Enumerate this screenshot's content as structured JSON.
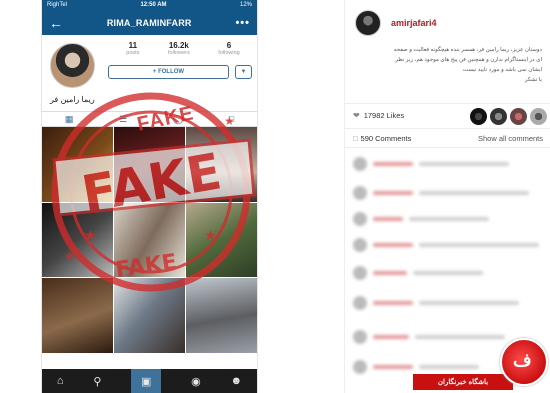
{
  "phone": {
    "status": {
      "carrier": "RighTel",
      "time": "12:50 AM",
      "battery": "12%"
    },
    "username": "RIMA_RAMINFARR",
    "stats": [
      {
        "num": "11",
        "label": "posts"
      },
      {
        "num": "16.2k",
        "label": "followers"
      },
      {
        "num": "6",
        "label": "following"
      }
    ],
    "follow_label": "+ FOLLOW",
    "display_name": "ریما رامین فر",
    "stamp_text": "FAKE",
    "icons": {
      "back": "back-arrow-icon",
      "more": "more-dots-icon",
      "home": "home-icon",
      "search": "search-icon",
      "camera": "camera-icon",
      "activity": "activity-icon",
      "profile": "profile-icon"
    }
  },
  "post": {
    "username": "amirjafari4",
    "caption": [
      "دوستان عزیز، ریما رامین فر، همسر بنده هیچگونه فعالیت و صفحه",
      "ای در اینستاگرام ندارن و همچنین فن پیج های موجود هم، زیر نظر",
      "ایشان نمی باشد و مورد تایید نیست",
      "با تشکر"
    ],
    "likes": "17982 Likes",
    "comments": "590 Comments",
    "show_all": "Show all comments"
  },
  "watermark": {
    "text": "باشگاه خبرنگاران",
    "colors": {
      "badge": "#c91010",
      "accent": "#d32b2b"
    }
  }
}
